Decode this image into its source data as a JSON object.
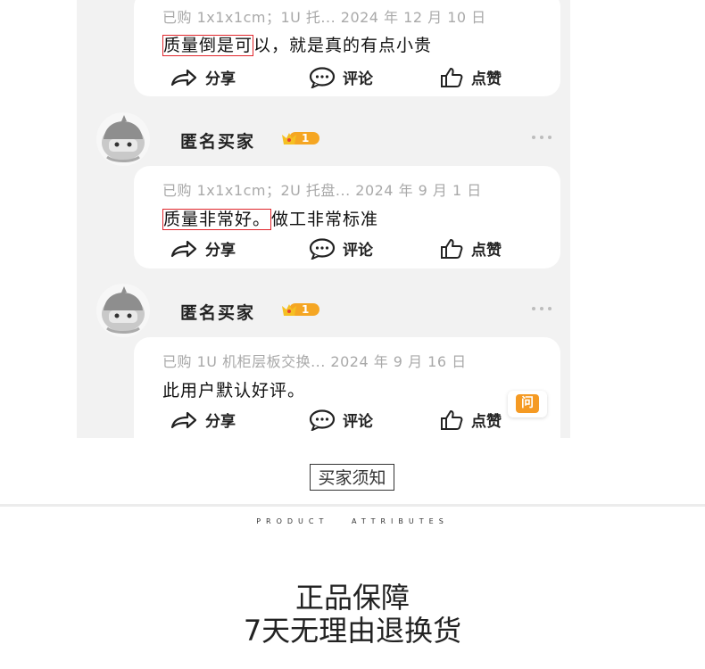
{
  "reviews": [
    {
      "user_name": "",
      "level": "",
      "meta": "已购 1x1x1cm；1U 托... 2024 年 12 月 10 日",
      "content_highlight": "质量倒是可",
      "content_rest": "以，就是真的有点小贵"
    },
    {
      "user_name": "匿名买家",
      "level": "1",
      "meta": "已购 1x1x1cm；2U 托盘... 2024 年 9 月 1 日",
      "content_highlight": "质量非常好。",
      "content_rest": "做工非常标准"
    },
    {
      "user_name": "匿名买家",
      "level": "1",
      "meta": "已购 1U 机柜层板交换... 2024 年 9 月 16 日",
      "content_highlight": "",
      "content_rest": "此用户默认好评。"
    }
  ],
  "actions": {
    "share": "分享",
    "comment": "评论",
    "like": "点赞"
  },
  "chat_button": "问",
  "buyer_notice": "买家须知",
  "product_attributes": "PRODUCT   ATTRIBUTES",
  "headline_1": "正品保障",
  "headline_2": "7天无理由退换货",
  "colors": {
    "highlight_border": "#e0262c",
    "level_badge": "#f5a623",
    "chat_accent": "#f59a23"
  }
}
